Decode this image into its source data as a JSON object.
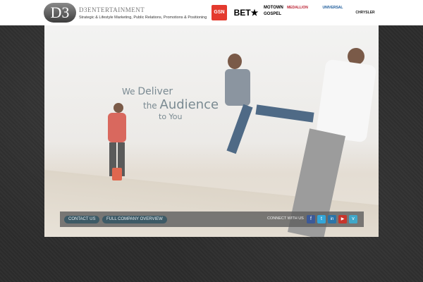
{
  "header": {
    "logo_text": "D3",
    "brand_name": "D3ENTERTAINMENT",
    "tagline": "Strategic & Lifestyle Marketing, Public Relations, Promotions & Positioning",
    "partners": [
      {
        "name": "GSN",
        "label": "GSN"
      },
      {
        "name": "BET",
        "label": "BET★"
      },
      {
        "name": "Motown Gospel",
        "label": "MOTOWN GOSPEL"
      },
      {
        "name": "Medallion",
        "label": "MEDALLION"
      },
      {
        "name": "Universal Music Group",
        "label": "UNIVERSAL"
      },
      {
        "name": "Chrysler",
        "label": "CHRYSLER"
      }
    ]
  },
  "hero": {
    "line1_prefix": "We ",
    "line1_big": "Deliver",
    "line2_prefix": "the ",
    "line2_big": "Audience",
    "line3": "to You"
  },
  "bottom_bar": {
    "contact_label": "CONTACT US",
    "overview_label": "FULL COMPANY OVERVIEW",
    "connect_label": "CONNECT WITH US",
    "social": [
      {
        "icon": "facebook-icon",
        "glyph": "f",
        "color": "#3b5998"
      },
      {
        "icon": "twitter-icon",
        "glyph": "t",
        "color": "#33a6d9"
      },
      {
        "icon": "linkedin-icon",
        "glyph": "in",
        "color": "#2a74a8"
      },
      {
        "icon": "youtube-icon",
        "glyph": "▶",
        "color": "#c8352c"
      },
      {
        "icon": "vimeo-icon",
        "glyph": "v",
        "color": "#3fa7c9"
      }
    ]
  },
  "colors": {
    "background": "#2e2e2e",
    "headline": "#7a8a92",
    "pill": "#3d5a66"
  }
}
